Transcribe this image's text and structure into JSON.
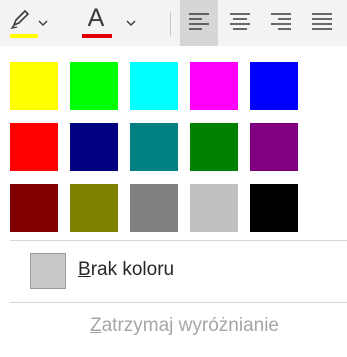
{
  "toolbar": {
    "highlight_color": "#ffff00",
    "font_color_letter": "A",
    "font_color_color": "#e00000",
    "align_buttons": [
      {
        "name": "align-left",
        "active": true
      },
      {
        "name": "align-center",
        "active": false
      },
      {
        "name": "align-right",
        "active": false
      },
      {
        "name": "justify",
        "active": false
      }
    ]
  },
  "palette": {
    "colors": [
      "#ffff00",
      "#00ff00",
      "#00ffff",
      "#ff00ff",
      "#0000ff",
      "#ff0000",
      "#000080",
      "#008080",
      "#008000",
      "#800080",
      "#800000",
      "#808000",
      "#808080",
      "#c0c0c0",
      "#000000"
    ]
  },
  "no_color": {
    "accel": "B",
    "rest": "rak koloru",
    "swatch_color": "#c8c8c8"
  },
  "stop_highlighting": {
    "accel": "Z",
    "rest": "atrzymaj wyróżnianie"
  }
}
